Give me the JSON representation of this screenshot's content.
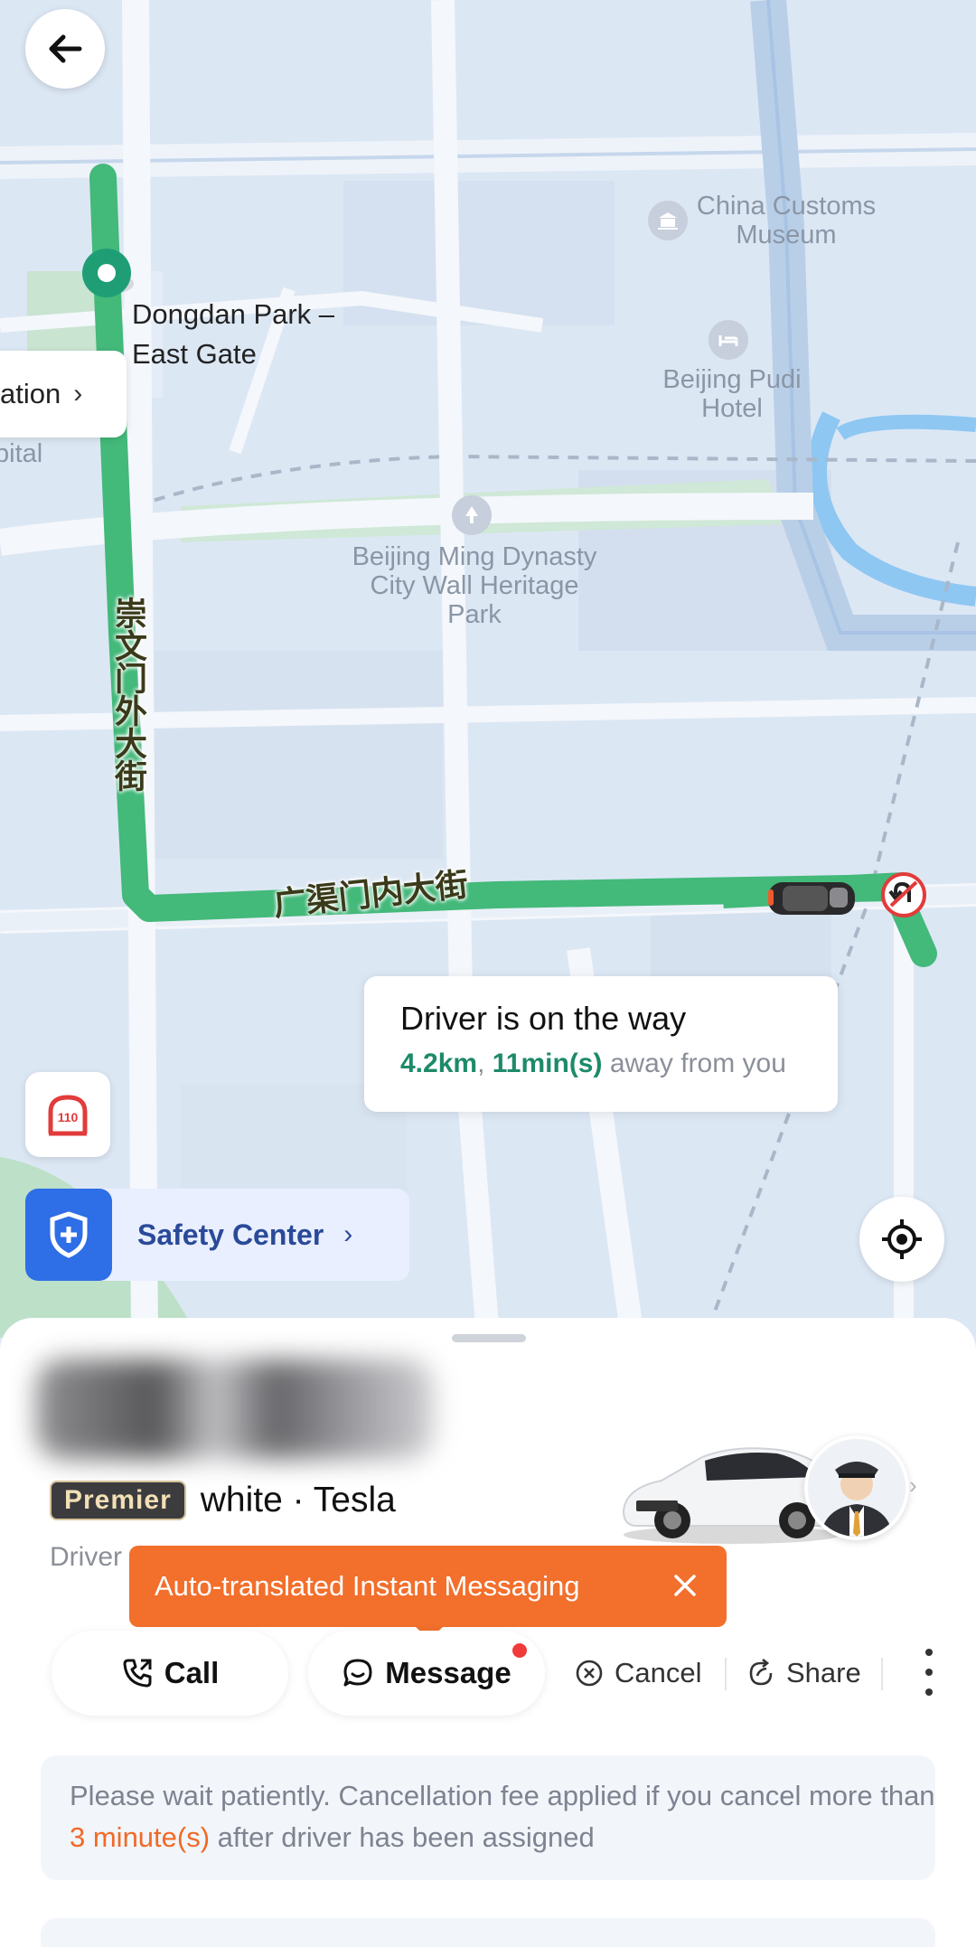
{
  "map": {
    "places": {
      "dongdan_park": "Dongdan Park –\nEast Gate",
      "customs_museum": "China Customs\nMuseum",
      "pudi_hotel": "Beijing Pudi\nHotel",
      "ming_wall_park": "Beijing Ming Dynasty\nCity Wall Heritage\nPark",
      "hospital_fragment": "pital"
    },
    "streets": {
      "chongwenmen": "崇文门外大街",
      "guangqumen": "广渠门内大街"
    },
    "side_pill_label": "ation",
    "emergency_label": "110",
    "colors": {
      "route": "#43b97a",
      "map_bg": "#dde8f5"
    }
  },
  "status_card": {
    "title": "Driver is on the way",
    "distance": "4.2km",
    "separator": ",",
    "eta": "11min(s)",
    "suffix": "away from you"
  },
  "safety_center": {
    "label": "Safety Center"
  },
  "trip": {
    "vehicle_class": "Premier",
    "car_description": "white · Tesla",
    "driver_label": "Driver"
  },
  "tooltip": {
    "text": "Auto-translated Instant Messaging"
  },
  "actions": {
    "call": "Call",
    "message": "Message",
    "cancel": "Cancel",
    "share": "Share"
  },
  "notice": {
    "before": "Please wait patiently. Cancellation fee applied if you cancel more than ",
    "highlight": "3 minute(s)",
    "after": " after driver has been assigned"
  },
  "icons": [
    "back-arrow-icon",
    "chevron-right-icon",
    "sos-110-icon",
    "shield-plus-icon",
    "locate-icon",
    "phone-icon",
    "chat-bubble-icon",
    "close-circle-icon",
    "share-icon",
    "more-vertical-icon",
    "close-icon",
    "pickup-pin-icon",
    "u-turn-icon",
    "car-icon",
    "driver-avatar-icon",
    "museum-icon",
    "hotel-icon",
    "park-icon"
  ]
}
